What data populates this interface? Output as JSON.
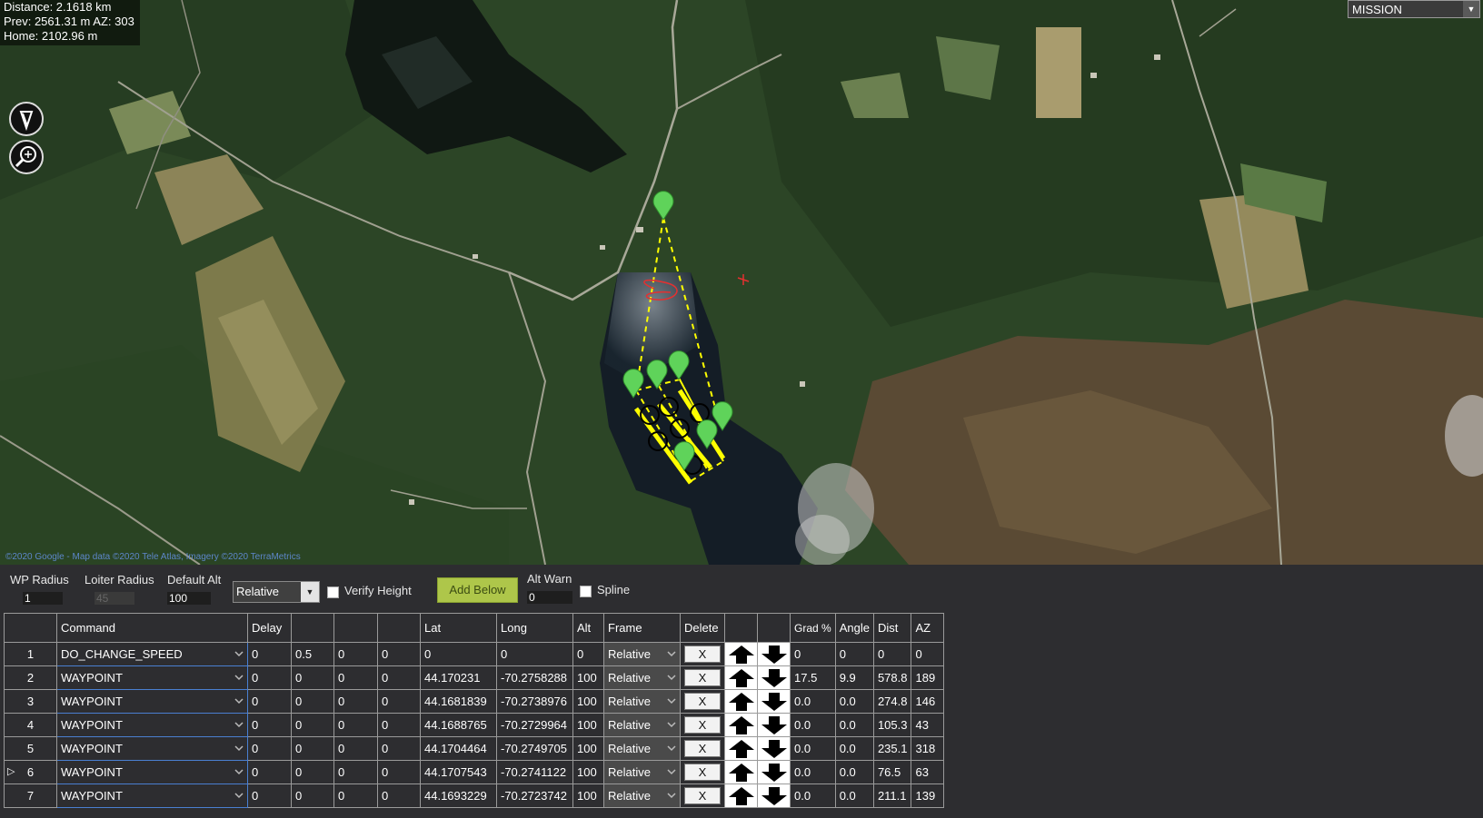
{
  "map": {
    "info_distance": "Distance: 2.1618 km",
    "info_prev": "Prev: 2561.31 m AZ: 303",
    "info_home": "Home: 2102.96 m",
    "mode": "MISSION",
    "attribution": "©2020 Google - Map data ©2020 Tele Atlas, Imagery ©2020 TerraMetrics",
    "icons": [
      "measure-icon",
      "zoom-icon"
    ]
  },
  "controls": {
    "wp_radius_label": "WP Radius",
    "wp_radius_value": "1",
    "loiter_radius_label": "Loiter Radius",
    "loiter_radius_value": "45",
    "default_alt_label": "Default Alt",
    "default_alt_value": "100",
    "frame_select": "Relative",
    "verify_height_label": "Verify Height",
    "add_below_label": "Add Below",
    "alt_warn_label": "Alt Warn",
    "alt_warn_value": "0",
    "spline_label": "Spline"
  },
  "grid": {
    "headers": {
      "command": "Command",
      "delay": "Delay",
      "p2": "",
      "p3": "",
      "p4": "",
      "lat": "Lat",
      "long": "Long",
      "alt": "Alt",
      "frame": "Frame",
      "delete": "Delete",
      "up": "",
      "down": "",
      "grad": "Grad %",
      "angle": "Angle",
      "dist": "Dist",
      "az": "AZ"
    },
    "delete_label": "X",
    "rows": [
      {
        "num": "1",
        "command": "DO_CHANGE_SPEED",
        "delay": "0",
        "p2": "0.5",
        "p3": "0",
        "p4": "0",
        "lat": "0",
        "long": "0",
        "alt": "0",
        "frame": "Relative",
        "grad": "0",
        "angle": "0",
        "dist": "0",
        "az": "0"
      },
      {
        "num": "2",
        "command": "WAYPOINT",
        "delay": "0",
        "p2": "0",
        "p3": "0",
        "p4": "0",
        "lat": "44.170231",
        "long": "-70.2758288",
        "alt": "100",
        "frame": "Relative",
        "grad": "17.5",
        "angle": "9.9",
        "dist": "578.8",
        "az": "189"
      },
      {
        "num": "3",
        "command": "WAYPOINT",
        "delay": "0",
        "p2": "0",
        "p3": "0",
        "p4": "0",
        "lat": "44.1681839",
        "long": "-70.2738976",
        "alt": "100",
        "frame": "Relative",
        "grad": "0.0",
        "angle": "0.0",
        "dist": "274.8",
        "az": "146"
      },
      {
        "num": "4",
        "command": "WAYPOINT",
        "delay": "0",
        "p2": "0",
        "p3": "0",
        "p4": "0",
        "lat": "44.1688765",
        "long": "-70.2729964",
        "alt": "100",
        "frame": "Relative",
        "grad": "0.0",
        "angle": "0.0",
        "dist": "105.3",
        "az": "43"
      },
      {
        "num": "5",
        "command": "WAYPOINT",
        "delay": "0",
        "p2": "0",
        "p3": "0",
        "p4": "0",
        "lat": "44.1704464",
        "long": "-70.2749705",
        "alt": "100",
        "frame": "Relative",
        "grad": "0.0",
        "angle": "0.0",
        "dist": "235.1",
        "az": "318"
      },
      {
        "num": "6",
        "command": "WAYPOINT",
        "delay": "0",
        "p2": "0",
        "p3": "0",
        "p4": "0",
        "lat": "44.1707543",
        "long": "-70.2741122",
        "alt": "100",
        "frame": "Relative",
        "grad": "0.0",
        "angle": "0.0",
        "dist": "76.5",
        "az": "63",
        "current": true
      },
      {
        "num": "7",
        "command": "WAYPOINT",
        "delay": "0",
        "p2": "0",
        "p3": "0",
        "p4": "0",
        "lat": "44.1693229",
        "long": "-70.2723742",
        "alt": "100",
        "frame": "Relative",
        "grad": "0.0",
        "angle": "0.0",
        "dist": "211.1",
        "az": "139"
      }
    ]
  },
  "colors": {
    "background": "#2d2d30",
    "add_button": "#aec64a",
    "waypoint_marker": "#5fd35a",
    "mission_path": "#ffff00",
    "selected_cell_border": "#4a7fd1"
  }
}
